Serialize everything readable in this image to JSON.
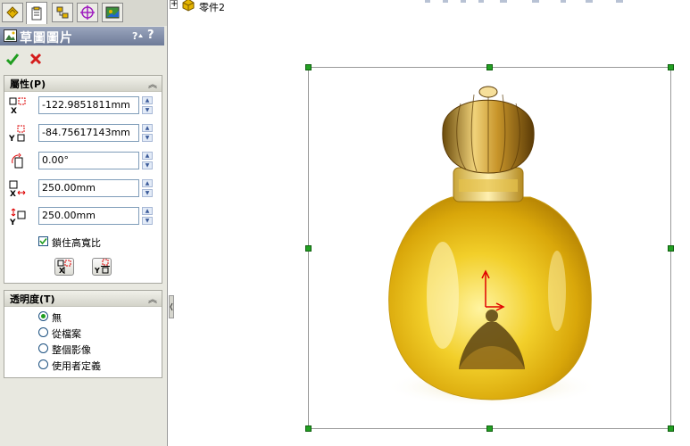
{
  "panel": {
    "tab_icons": [
      "feature-manager-icon",
      "property-manager-icon",
      "configuration-manager-icon",
      "dimxpert-icon",
      "display-manager-icon"
    ],
    "title": "草圖圖片",
    "help_glyph": "?",
    "properties_group": {
      "title": "屬性(P)",
      "x_position": "-122.9851811mm",
      "y_position": "-84.75617143mm",
      "angle": "0.00°",
      "width": "250.00mm",
      "height": "250.00mm",
      "lock_aspect_label": "鎖住高寬比",
      "lock_aspect_checked": true
    },
    "transparency_group": {
      "title": "透明度(T)",
      "options": [
        "無",
        "從檔案",
        "整個影像",
        "使用者定義"
      ],
      "selected": "無"
    }
  },
  "tree": {
    "expander": "+",
    "part_label": "零件2"
  },
  "colors": {
    "title_bar": "#6e7b98",
    "panel_bg": "#e8e8e0",
    "handle": "#22a022",
    "axis_red": "#e00000"
  }
}
